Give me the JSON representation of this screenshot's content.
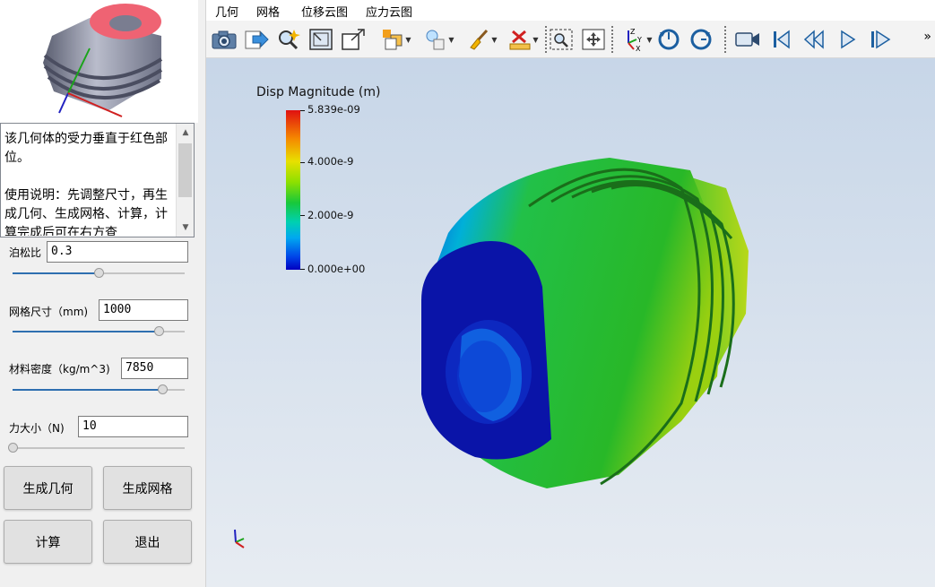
{
  "description": {
    "text": "该几何体的受力垂直于红色部位。\n\n使用说明：先调整尺寸，再生成几何、生成网格、计算，计算完成后可在右方查"
  },
  "params": [
    {
      "label": "泊松比",
      "value": "0.3",
      "slider": 0.5
    },
    {
      "label": "网格尺寸（mm)",
      "value": "1000",
      "slider": 0.85
    },
    {
      "label": "材料密度（kg/m^3)",
      "value": "7850",
      "slider": 0.87
    },
    {
      "label": "力大小（N)",
      "value": "10",
      "slider": 0.0
    }
  ],
  "buttons": {
    "gen_geometry": "生成几何",
    "gen_mesh": "生成网格",
    "compute": "计算",
    "exit": "退出"
  },
  "menu": [
    "几何",
    "网格",
    "位移云图",
    "应力云图"
  ],
  "toolbar": {
    "icons": [
      "camera-icon",
      "export-icon",
      "zoom-magic-icon",
      "fit-window-icon",
      "resize-icon",
      "display-mode-icon",
      "light-icon",
      "brush-icon",
      "measure-icon",
      "zoom-box-icon",
      "pan-icon",
      "axes-icon",
      "rotate-ccw-icon",
      "rotate-cw-icon",
      "record-icon",
      "first-frame-icon",
      "prev-frame-icon",
      "play-icon",
      "next-frame-icon"
    ],
    "overflow": "»"
  },
  "legend": {
    "title": "Disp Magnitude (m)",
    "labels": [
      "5.839e-09",
      "4.000e-9",
      "2.000e-9",
      "0.000e+00"
    ]
  },
  "colors": {
    "max": "#e01010",
    "min": "#0000c0",
    "loaded_face": "#f06070",
    "slider_fill": "#2e6fb0"
  }
}
